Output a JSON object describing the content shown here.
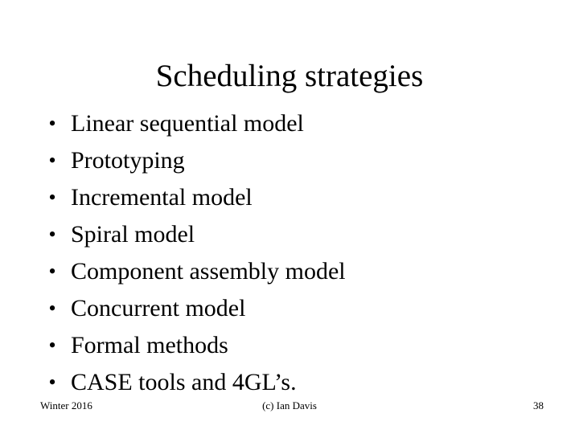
{
  "slide": {
    "title": "Scheduling strategies",
    "bullet_marker": "•",
    "bullets": [
      {
        "label": "Linear sequential model"
      },
      {
        "label": "Prototyping"
      },
      {
        "label": "Incremental model"
      },
      {
        "label": "Spiral model"
      },
      {
        "label": "Component assembly model"
      },
      {
        "label": "Concurrent model"
      },
      {
        "label": "Formal methods"
      },
      {
        "label": "CASE tools and 4GL’s."
      }
    ],
    "footer": {
      "left": "Winter 2016",
      "center": "(c) Ian Davis",
      "page_number": "38"
    },
    "colors": {
      "background": "#ffffff",
      "text": "#000000"
    }
  }
}
